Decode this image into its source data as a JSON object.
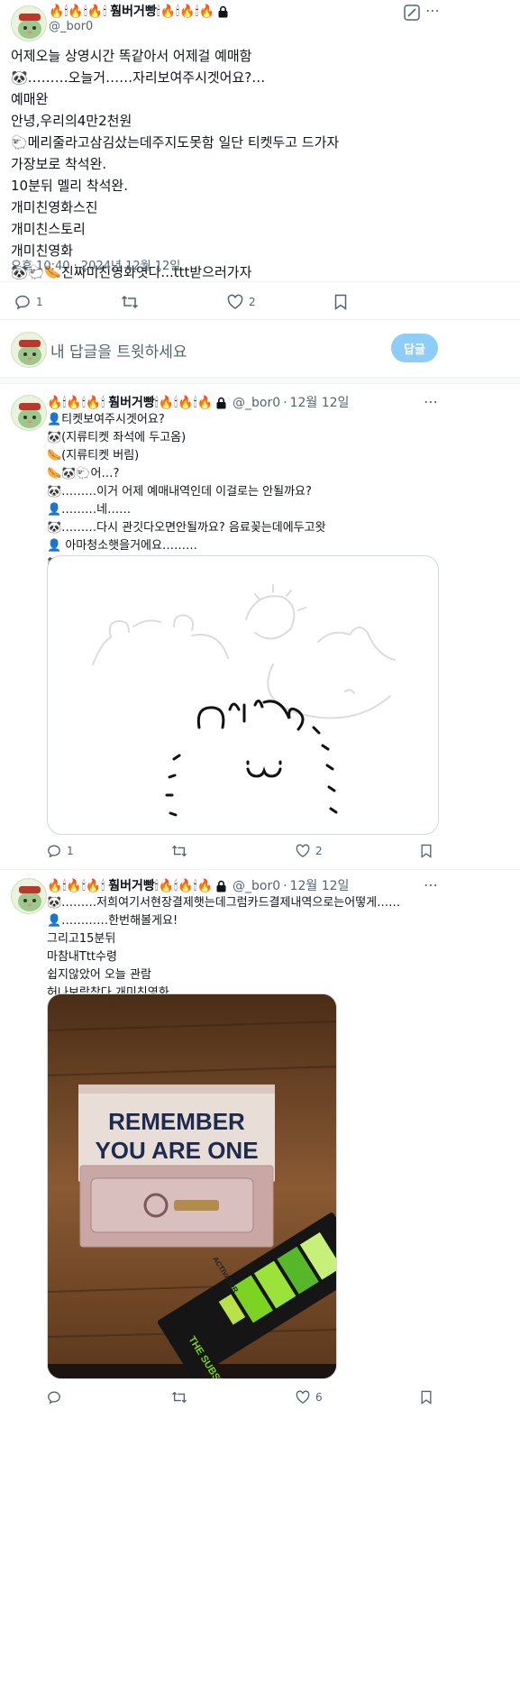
{
  "main_tweet": {
    "display_name": "훰버거빵",
    "name_prefix_emojis": "🔥🕯🔥🕯🔥🕯",
    "name_suffix_emojis": "🕯🔥🕯🔥🕯🔥",
    "handle": "@_bor0",
    "lines": [
      "어제오늘 상영시간 똑같아서 어제걸 예매함",
      "🐼………오늘거……자리보여주시겟어요?…",
      "예매완",
      "안녕,우리의4만2천원",
      "🐑메리줄라고삼김샀는데주지도못함 일단 티켓두고 드가자",
      "가장보로 착석완.",
      "10분뒤 멜리 착석완.",
      "개미친영화스진",
      "개미친스토리",
      "개미친영화",
      "🐼🐑🌭진짜미친영화엿다...ttt받으러가자"
    ],
    "timestamp": "오후 10:40 · 2024년 12월 12일",
    "replies": "1",
    "likes": "2"
  },
  "composer": {
    "placeholder": "내 답글을 트윗하세요",
    "button_label": "답글"
  },
  "reply1": {
    "display_name": "훰버거빵",
    "name_prefix_emojis": "🔥🕯🔥🕯🔥🕯",
    "name_suffix_emojis": "🕯🔥🕯🔥🕯🔥",
    "handle": "@_bor0",
    "date": "12월 12일",
    "lines": [
      "👤티켓보여주시겟어요?",
      "🐼(지류티켓 좌석에 두고옴)",
      "🌭(지류티켓 버림)",
      "🌭🐼🐑어…?",
      "🐼………이거 어제 예매내역인데 이걸로는 안될까요?",
      "👤………네……",
      "🐼………다시 관깃다오면안될까요? 음료꽂는데에두고왓",
      "👤 아마청소햇을거에요………",
      "🐼🐑🌭"
    ],
    "replies": "1",
    "likes": "2"
  },
  "reply2": {
    "display_name": "훰버거빵",
    "name_prefix_emojis": "🔥🕯🔥🕯🔥🕯",
    "name_suffix_emojis": "🕯🔥🕯🔥🕯🔥",
    "handle": "@_bor0",
    "date": "12월 12일",
    "lines": [
      "🐼………저희여기서현장결제햇는데그럼카드결제내역으로는어떻게……",
      "👤…………한번해볼게요!",
      "그리고15분뒤",
      "마참내Ttt수령",
      "쉽지않았어 오늘 관람",
      "허나보람찼다.개미친영화…"
    ],
    "photo_sign_line1": "REMEMBER",
    "photo_sign_line2": "YOU ARE ONE",
    "photo_card_title": "THE SUBSTANCE",
    "photo_card_small": "ACTIVATOR",
    "likes": "6"
  },
  "colors": {
    "text": "#0f1419",
    "secondary": "#536471",
    "divider": "#eff3f4",
    "reply_button": "#8ecdf8"
  },
  "icons": [
    "avatar",
    "lock-icon",
    "edit-icon",
    "more-icon",
    "reply-icon",
    "retweet-icon",
    "like-icon",
    "bookmark-icon"
  ]
}
